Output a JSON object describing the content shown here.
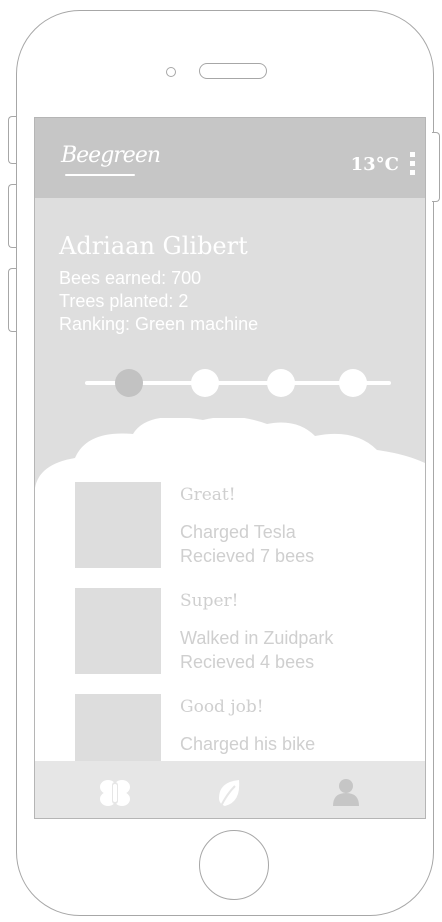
{
  "app": {
    "logo_text": "Beegreen",
    "temperature": "13°C"
  },
  "profile": {
    "name": "Adriaan Glibert",
    "bees_earned": "Bees earned: 700",
    "trees_planted": "Trees planted: 2",
    "ranking": "Ranking: Green machine"
  },
  "progress": {
    "steps_total": 4,
    "current_step": 1
  },
  "activities": [
    {
      "title": "Great!",
      "line1": "Charged Tesla",
      "line2": "Recieved 7 bees"
    },
    {
      "title": "Super!",
      "line1": "Walked in Zuidpark",
      "line2": "Recieved 4 bees"
    },
    {
      "title": "Good job!",
      "line1": "Charged his bike",
      "line2": ""
    }
  ],
  "nav": {
    "items": [
      {
        "icon": "bee-icon"
      },
      {
        "icon": "leaf-icon"
      },
      {
        "icon": "profile-icon"
      }
    ]
  },
  "colors": {
    "screen_bg": "#dedede",
    "topbar_bg": "#c6c6c6",
    "frame": "#a7a7a7",
    "card_text": "#cfcfcf"
  }
}
